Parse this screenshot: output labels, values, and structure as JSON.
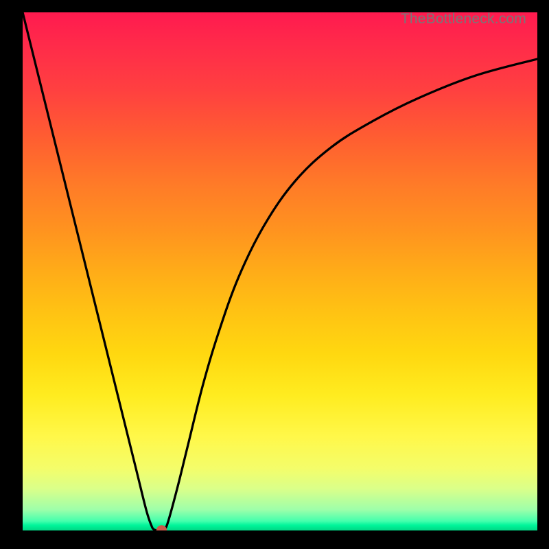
{
  "watermark": "TheBottleneck.com",
  "chart_data": {
    "type": "line",
    "title": "",
    "xlabel": "",
    "ylabel": "",
    "xlim": [
      0,
      100
    ],
    "ylim": [
      0,
      100
    ],
    "series": [
      {
        "name": "curve",
        "x": [
          0,
          3,
          6,
          10,
          14,
          18,
          22,
          24,
          25,
          25.5,
          26.2,
          27,
          27.5,
          28.2,
          30,
          32,
          35,
          38,
          42,
          47,
          53,
          60,
          68,
          77,
          88,
          100
        ],
        "y": [
          100,
          88,
          76,
          60,
          44,
          28,
          12,
          4,
          1,
          0.2,
          0,
          0,
          0.2,
          1.5,
          8,
          16,
          28,
          38,
          49,
          59,
          67.5,
          74,
          79,
          83.5,
          87.8,
          91
        ]
      }
    ],
    "marker": {
      "x": 27,
      "y": 0,
      "color": "#cb5a4b"
    },
    "background_gradient": {
      "top": "#ff1a4f",
      "mid": "#ffd810",
      "bottom": "#00d784"
    }
  }
}
